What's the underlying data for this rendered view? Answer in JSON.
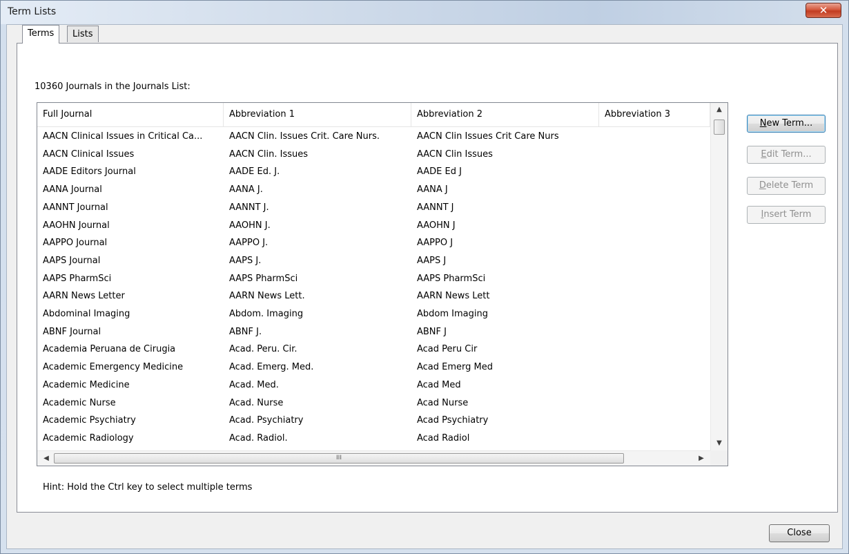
{
  "window": {
    "title": "Term Lists",
    "close_glyph": "✕"
  },
  "tabs": [
    {
      "label": "Terms",
      "active": true
    },
    {
      "label": "Lists",
      "active": false
    }
  ],
  "count_label": "10360 Journals in the Journals List:",
  "columns": [
    "Full Journal",
    "Abbreviation 1",
    "Abbreviation 2",
    "Abbreviation 3"
  ],
  "rows": [
    [
      "AACN Clinical Issues in Critical Ca...",
      "AACN Clin. Issues Crit. Care Nurs.",
      "AACN Clin Issues Crit Care Nurs",
      ""
    ],
    [
      "AACN Clinical Issues",
      "AACN Clin. Issues",
      "AACN Clin Issues",
      ""
    ],
    [
      "AADE Editors Journal",
      "AADE Ed. J.",
      "AADE Ed J",
      ""
    ],
    [
      "AANA Journal",
      "AANA J.",
      "AANA J",
      ""
    ],
    [
      "AANNT Journal",
      "AANNT J.",
      "AANNT J",
      ""
    ],
    [
      "AAOHN Journal",
      "AAOHN J.",
      "AAOHN J",
      ""
    ],
    [
      "AAPPO Journal",
      "AAPPO J.",
      "AAPPO J",
      ""
    ],
    [
      "AAPS Journal",
      "AAPS J.",
      "AAPS J",
      ""
    ],
    [
      "AAPS PharmSci",
      "AAPS PharmSci",
      "AAPS PharmSci",
      ""
    ],
    [
      "AARN News Letter",
      "AARN News Lett.",
      "AARN News Lett",
      ""
    ],
    [
      "Abdominal Imaging",
      "Abdom. Imaging",
      "Abdom Imaging",
      ""
    ],
    [
      "ABNF Journal",
      "ABNF J.",
      "ABNF J",
      ""
    ],
    [
      "Academia Peruana de Cirugia",
      "Acad. Peru. Cir.",
      "Acad Peru Cir",
      ""
    ],
    [
      "Academic Emergency Medicine",
      "Acad. Emerg. Med.",
      "Acad Emerg Med",
      ""
    ],
    [
      "Academic Medicine",
      "Acad. Med.",
      "Acad Med",
      ""
    ],
    [
      "Academic Nurse",
      "Acad. Nurse",
      "Acad Nurse",
      ""
    ],
    [
      "Academic Psychiatry",
      "Acad. Psychiatry",
      "Acad Psychiatry",
      ""
    ],
    [
      "Academic Radiology",
      "Acad. Radiol.",
      "Acad Radiol",
      ""
    ]
  ],
  "buttons": {
    "new_term": {
      "hotkey": "N",
      "rest": "ew Term...",
      "enabled": true
    },
    "edit_term": {
      "hotkey": "E",
      "rest": "dit Term...",
      "enabled": false
    },
    "delete_term": {
      "hotkey": "D",
      "rest": "elete Term",
      "enabled": false
    },
    "insert_term": {
      "hotkey": "I",
      "rest": "nsert Term",
      "enabled": false
    }
  },
  "scroll": {
    "up": "▲",
    "down": "▼",
    "left": "◀",
    "right": "▶",
    "grip": "III"
  },
  "hint": "Hint: Hold the Ctrl key to select multiple terms",
  "close_label": "Close"
}
